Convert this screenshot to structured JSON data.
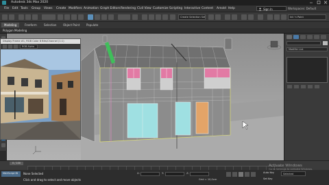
{
  "app": {
    "title": "Autodesk 3ds Max 2020"
  },
  "menubar": {
    "items": [
      "File",
      "Edit",
      "Tools",
      "Group",
      "Views",
      "Create",
      "Modifiers",
      "Animation",
      "Graph Editors",
      "Rendering",
      "Civil View",
      "Customize",
      "Scripting",
      "Interactive",
      "Content",
      "Arnold",
      "Help"
    ],
    "signin": "Sign In",
    "workspaces": "Workspaces: Default"
  },
  "toolbar": {
    "selection_set": "Create Selection Set",
    "right_field": "Ink 'n Paint"
  },
  "ribbon": {
    "tabs": [
      "Modeling",
      "Freeform",
      "Selection",
      "Object Paint",
      "Populate"
    ],
    "active_tab": "Modeling",
    "sub": "Polygon Modeling"
  },
  "reference_window": {
    "title": "Display Frame #1, RGB Color 8 Bits/Channel (1:1)",
    "channel": "RGB Alpha"
  },
  "command_panel": {
    "modifier_list": "Modifier List"
  },
  "timeline": {
    "frame": "0 / 100"
  },
  "status": {
    "maxscript": "MAXScript Mi",
    "msg1": "None Selected",
    "msg2": "Click and drag to select and move objects",
    "x_label": "X:",
    "y_label": "Y:",
    "z_label": "Z:",
    "grid": "Grid = 10,0cm",
    "autokey": "Auto Key",
    "setkey": "Set Key",
    "selected": "Selected",
    "activate_title": "Activate Windows",
    "activate_sub": "Go to Settings to activate Windows."
  },
  "colors": {
    "viewport_bg": "#9a9a9a",
    "wireframe": "#d9d9d9",
    "selection_outline": "#e8e870",
    "window_pink": "#e27aa4",
    "door_cyan": "#9fe0e2",
    "door_orange": "#e3a468",
    "pipe_green": "#3fbf5a"
  }
}
